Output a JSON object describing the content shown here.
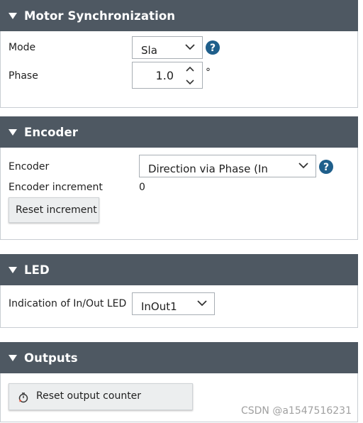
{
  "motor_sync": {
    "title": "Motor Synchronization",
    "mode_label": "Mode",
    "mode_value": "Sla",
    "phase_label": "Phase",
    "phase_value": "1.0",
    "phase_unit": "°"
  },
  "encoder": {
    "title": "Encoder",
    "encoder_label": "Encoder",
    "encoder_value": "Direction via Phase (In",
    "increment_label": "Encoder increment",
    "increment_value": "0",
    "reset_increment_label": "Reset increment"
  },
  "led": {
    "title": "LED",
    "indication_label": "Indication of In/Out LED",
    "indication_value": "InOut1"
  },
  "outputs": {
    "title": "Outputs",
    "reset_counter_label": "Reset output counter"
  },
  "watermark": "CSDN @a1547516231",
  "colors": {
    "header_bg": "#4e5862",
    "help_icon": "#1f5f8b",
    "button_bg": "#eceeef",
    "reset_icon_accent": "#e04a2f"
  },
  "icons": {
    "collapse": "triangle-down-icon",
    "dropdown": "chevron-down-icon",
    "help": "question-circle-icon",
    "spin_up": "chevron-up-icon",
    "spin_down": "chevron-down-icon",
    "reset_counter": "reset-counter-icon"
  }
}
